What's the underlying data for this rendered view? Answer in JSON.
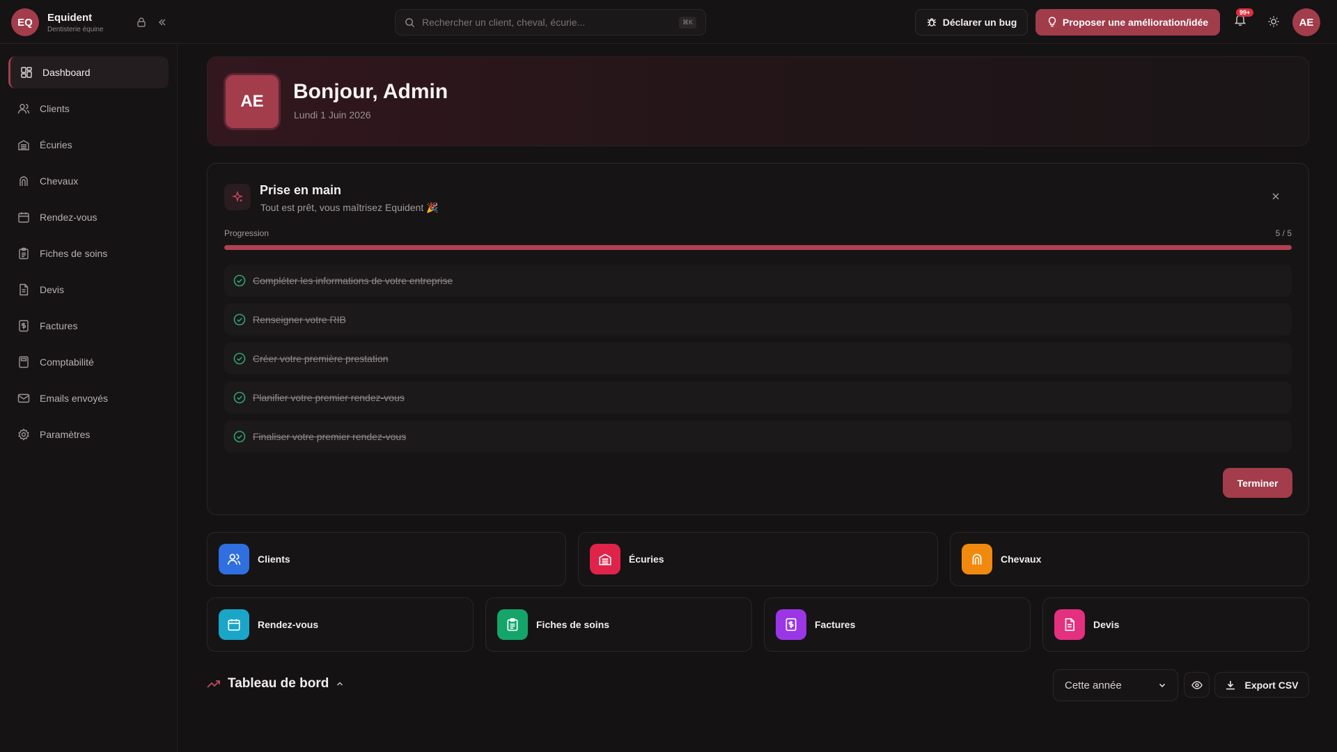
{
  "brand": {
    "logo": "EQ",
    "name": "Equident",
    "subtitle": "Dentisterie équine"
  },
  "search": {
    "placeholder": "Rechercher un client, cheval, écurie...",
    "shortcut": "⌘K"
  },
  "header": {
    "bug_label": "Déclarer un bug",
    "idea_label": "Proposer une amélioration/idée",
    "notifications_badge": "99+",
    "avatar": "AE"
  },
  "sidebar": {
    "items": [
      {
        "label": "Dashboard",
        "icon": "dashboard-icon",
        "active": true
      },
      {
        "label": "Clients",
        "icon": "users-icon"
      },
      {
        "label": "Écuries",
        "icon": "stable-icon"
      },
      {
        "label": "Chevaux",
        "icon": "horseshoe-icon"
      },
      {
        "label": "Rendez-vous",
        "icon": "calendar-icon"
      },
      {
        "label": "Fiches de soins",
        "icon": "clipboard-icon"
      },
      {
        "label": "Devis",
        "icon": "file-icon"
      },
      {
        "label": "Factures",
        "icon": "invoice-icon"
      },
      {
        "label": "Comptabilité",
        "icon": "calculator-icon"
      },
      {
        "label": "Emails envoyés",
        "icon": "mail-icon"
      },
      {
        "label": "Paramètres",
        "icon": "settings-icon"
      }
    ]
  },
  "hero": {
    "avatar": "AE",
    "title": "Bonjour, Admin",
    "date": "Lundi 1 Juin 2026"
  },
  "onboarding": {
    "title": "Prise en main",
    "subtitle": "Tout est prêt, vous maîtrisez Equident 🎉",
    "progress_label": "Progression",
    "progress_count": "5 / 5",
    "progress_fraction": 1.0,
    "tasks": [
      {
        "label": "Compléter les informations de votre entreprise",
        "done": true
      },
      {
        "label": "Renseigner votre RIB",
        "done": true
      },
      {
        "label": "Créer votre première prestation",
        "done": true
      },
      {
        "label": "Planifier votre premier rendez-vous",
        "done": true
      },
      {
        "label": "Finaliser votre premier rendez-vous",
        "done": true
      }
    ],
    "finish_label": "Terminer"
  },
  "quick_links": [
    {
      "label": "Clients",
      "icon": "users-icon",
      "color": "#2f6fe0"
    },
    {
      "label": "Écuries",
      "icon": "stable-icon",
      "color": "#e0234a"
    },
    {
      "label": "Chevaux",
      "icon": "horseshoe-icon",
      "color": "#f0890e"
    },
    {
      "label": "Rendez-vous",
      "icon": "calendar-icon",
      "color": "#1aa6c9"
    },
    {
      "label": "Fiches de soins",
      "icon": "clipboard-icon",
      "color": "#15a56b"
    },
    {
      "label": "Factures",
      "icon": "invoice-icon",
      "color": "#9b36e6"
    },
    {
      "label": "Devis",
      "icon": "file-icon",
      "color": "#e4307f"
    }
  ],
  "dashboard": {
    "title": "Tableau de bord",
    "period": "Cette année",
    "export_label": "Export CSV"
  }
}
